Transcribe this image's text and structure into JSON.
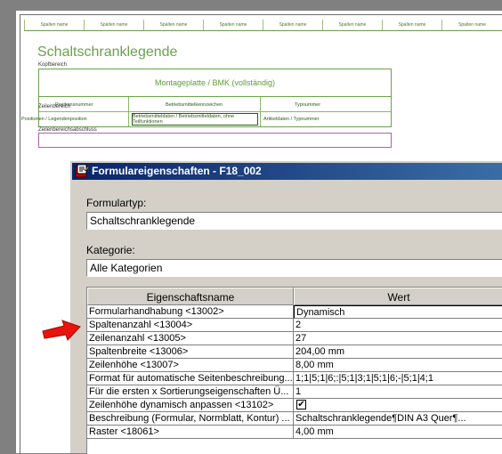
{
  "sheet": {
    "header_cells": [
      "Spalten name",
      "Spalten name",
      "Spalten name",
      "Spalten name",
      "Spalten name",
      "Spalten name",
      "Spalten name",
      "Spalten name"
    ],
    "title": "Schaltschranklegende",
    "kopfbereich_label": "Kopfbereich",
    "montage_label": "Montageplatte / BMK (vollständig)",
    "col_position": "Positionsnummer",
    "col_betriebsmittel": "Betriebsmittelkennzeichen",
    "col_typ": "Typnummer",
    "zeilenbereich_label": "Zeilenbereich",
    "row_position": "Positionen / Legendenposition",
    "row_betriebsmittel": "Betriebsmitteldaten / Betriebsmitteldaten, ohne Teilfunktionen",
    "row_typ": "Artikeldaten / Typnummer",
    "zeilenbereich_abschluss_label": "Zeilenbereichsabschluss"
  },
  "dialog": {
    "title": "Formulareigenschaften - F18_002",
    "formulartyp_label": "Formulartyp:",
    "formulartyp_value": "Schaltschranklegende",
    "kategorie_label": "Kategorie:",
    "kategorie_value": "Alle Kategorien",
    "grid": {
      "col_name": "Eigenschaftsname",
      "col_value": "Wert",
      "rows": [
        {
          "name": "Formularhandhabung <13002>",
          "value": "Dynamisch"
        },
        {
          "name": "Spaltenanzahl <13004>",
          "value": "2"
        },
        {
          "name": "Zeilenanzahl <13005>",
          "value": "27"
        },
        {
          "name": "Spaltenbreite <13006>",
          "value": "204,00 mm"
        },
        {
          "name": "Zeilenhöhe <13007>",
          "value": "8,00 mm"
        },
        {
          "name": "Format für automatische Seitenbeschreibung...",
          "value": "1;1|5;1|6;:|5;1|3;1|5;1|6;-|5;1|4;1"
        },
        {
          "name": "Für die ersten x Sortierungseigenschaften Ü...",
          "value": "1"
        },
        {
          "name": "Zeilenhöhe dynamisch anpassen <13102>",
          "value": "✔"
        },
        {
          "name": "Beschreibung (Formular, Normblatt, Kontur) ...",
          "value": "Schaltschranklegende¶DIN A3 Quer¶..."
        },
        {
          "name": "Raster <18061>",
          "value": "4,00 mm"
        }
      ]
    }
  },
  "colors": {
    "titlebar_start": "#0a246a",
    "titlebar_end": "#3a6ea5",
    "dialog_face": "#d4d0c8",
    "sheet_green": "#6aa24a",
    "arrow_red": "#e8140c"
  }
}
